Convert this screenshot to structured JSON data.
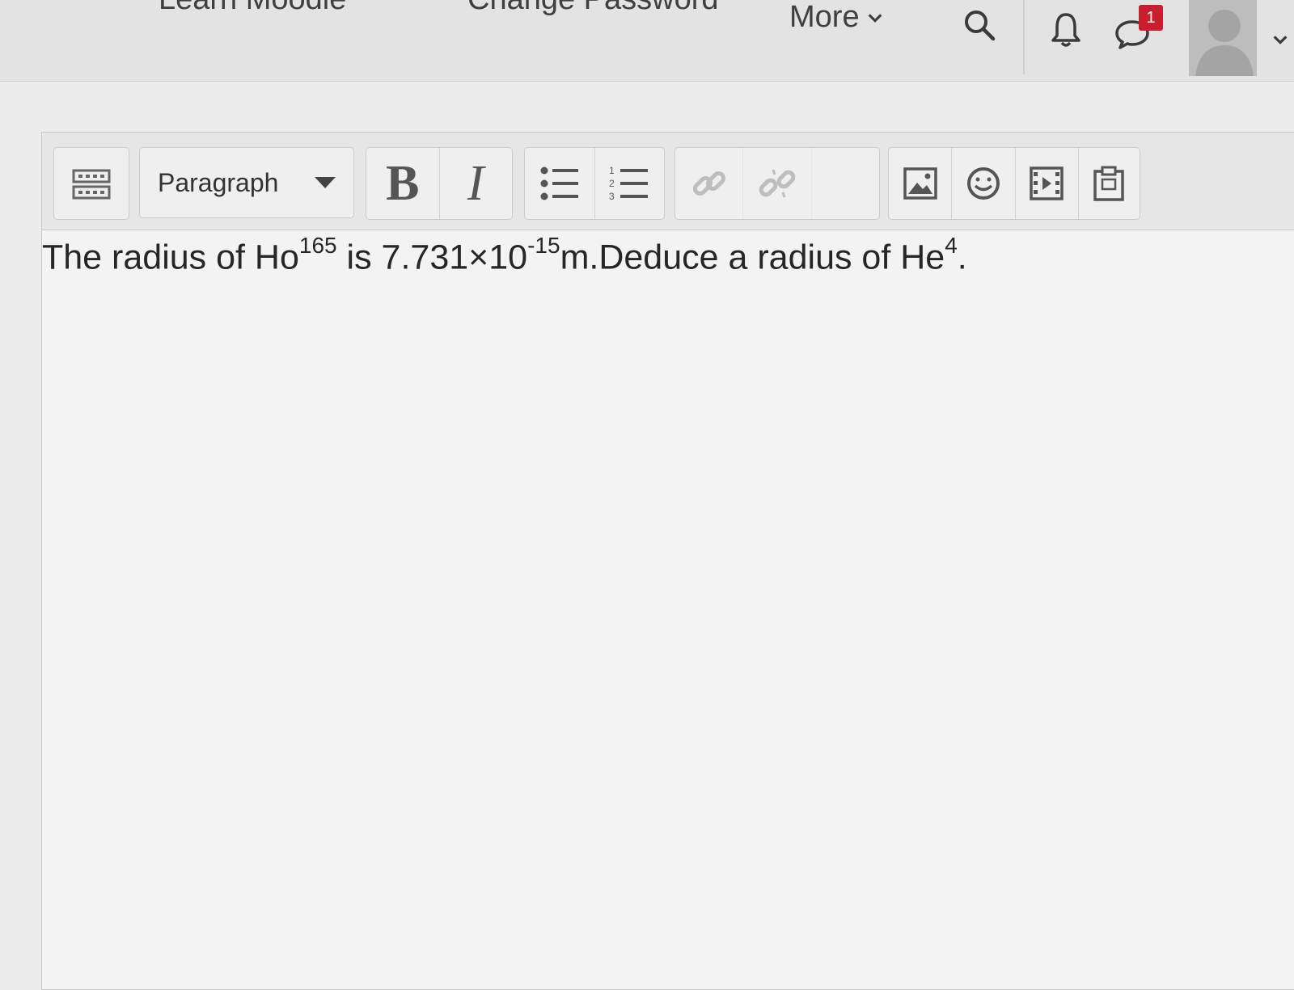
{
  "navbar": {
    "learn_moodle": "Learn Moodle",
    "change_password": "Change Password",
    "more": "More",
    "notification_count": "1"
  },
  "toolbar": {
    "paragraph_label": "Paragraph",
    "bold_label": "B",
    "italic_label": "I"
  },
  "content": {
    "part1": "The radius of Ho",
    "sup1": "165",
    "part2": " is 7.731×10",
    "sup2": "-15",
    "part3": "m.Deduce a radius of He",
    "sup3": "4",
    "part4": "."
  },
  "icons": [
    "toolbar-toggle-icon",
    "bullet-list-icon",
    "numbered-list-icon",
    "link-icon",
    "unlink-icon",
    "image-icon",
    "emoji-icon",
    "media-icon",
    "paste-icon",
    "search-icon",
    "bell-icon",
    "chat-icon",
    "user-avatar-icon",
    "chevron-down-icon"
  ],
  "colors": {
    "badge": "#c81e2e",
    "toolbar": "#e6e6e6",
    "editor_bg": "#f3f3f3"
  }
}
